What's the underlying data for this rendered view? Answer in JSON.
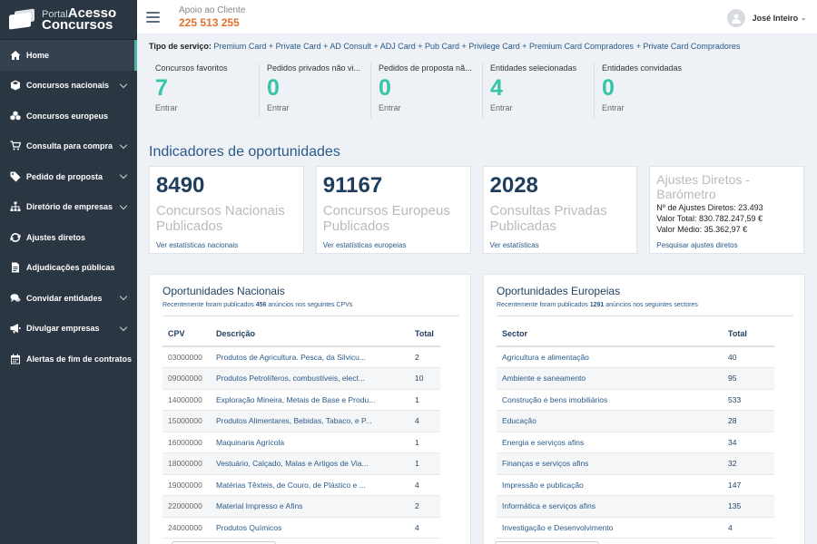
{
  "brand": {
    "portal": "Portal",
    "acesso": "Acesso",
    "concursos": "Concursos"
  },
  "header": {
    "support_label": "Apoio ao Cliente",
    "phone": "225 513 255",
    "user_name": "José Inteiro",
    "dropdown": "⌄"
  },
  "sidebar": {
    "items": [
      {
        "label": "Home",
        "icon": "home-icon",
        "chevron": false
      },
      {
        "label": "Concursos nacionais",
        "icon": "cube-icon",
        "chevron": true
      },
      {
        "label": "Concursos europeus",
        "icon": "cubes-icon",
        "chevron": false
      },
      {
        "label": "Consulta para compra",
        "icon": "cart-icon",
        "chevron": true
      },
      {
        "label": "Pedido de proposta",
        "icon": "tag-icon",
        "chevron": true
      },
      {
        "label": "Diretório de empresas",
        "icon": "sitemap-icon",
        "chevron": true
      },
      {
        "label": "Ajustes diretos",
        "icon": "refresh-icon",
        "chevron": false
      },
      {
        "label": "Adjudicações públicas",
        "icon": "document-icon",
        "chevron": false
      },
      {
        "label": "Convidar entidades",
        "icon": "chat-icon",
        "chevron": true
      },
      {
        "label": "Divulgar empresas",
        "icon": "megaphone-icon",
        "chevron": true
      },
      {
        "label": "Alertas de fim de contratos",
        "icon": "calendar-icon",
        "chevron": false
      }
    ]
  },
  "service": {
    "label": "Tipo de serviço:",
    "types": "Premium Card + Private Card + AD Consult + ADJ Card + Pub Card + Privilege Card + Premium Card Compradores + Private Card Compradores"
  },
  "favs": [
    {
      "title": "Concursos favoritos",
      "value": "7",
      "link": "Entrar"
    },
    {
      "title": "Pedidos privados não vi...",
      "value": "0",
      "link": "Entrar"
    },
    {
      "title": "Pedidos de proposta nã...",
      "value": "0",
      "link": "Entrar"
    },
    {
      "title": "Entidades selecionadas",
      "value": "4",
      "link": "Entrar"
    },
    {
      "title": "Entidades convidadas",
      "value": "0",
      "link": "Entrar"
    }
  ],
  "indicators": {
    "title": "Indicadores de oportunidades",
    "cards": [
      {
        "number": "8490",
        "desc": "Concursos Nacionais Publicados",
        "link": "Ver estatísticas nacionais"
      },
      {
        "number": "91167",
        "desc": "Concursos Europeus Publicados",
        "link": "Ver estatísticas europeias"
      },
      {
        "number": "2028",
        "desc": "Consultas Privadas Publicadas",
        "link": "Ver estatísticas"
      }
    ],
    "barometer": {
      "title": "Ajustes Diretos - Barómetro",
      "line1": "Nº de Ajustes Diretos: 23.493",
      "line2": "Valor Total: 830.782.247,59 €",
      "line3": "Valor Médio: 35.362,97 €",
      "link": "Pesquisar ajustes diretos"
    }
  },
  "nacional": {
    "title": "Oportunidades Nacionais",
    "subtitle_pre": "Recentemente foram publicados ",
    "subtitle_count": "456",
    "subtitle_post": " anúncios nos seguintes CPVs",
    "headers": [
      "CPV",
      "Descrição",
      "Total"
    ],
    "rows": [
      [
        "03000000",
        "Produtos de Agricultura. Pesca, da Silvicu...",
        "2"
      ],
      [
        "09000000",
        "Produtos Petrolíferos, combustíveis, elect...",
        "10"
      ],
      [
        "14000000",
        "Exploração Mineira, Metais de Base e Produ...",
        "1"
      ],
      [
        "15000000",
        "Produtos Alimentares, Bebidas, Tabaco, e P...",
        "4"
      ],
      [
        "16000000",
        "Maquinaria Agrícola",
        "1"
      ],
      [
        "18000000",
        "Vestuário, Calçado, Malas e Artigos de Via...",
        "1"
      ],
      [
        "19000000",
        "Matérias Têxteis, de Couro, de Plástico e ...",
        "4"
      ],
      [
        "22000000",
        "Material Impresso e Afins",
        "2"
      ],
      [
        "24000000",
        "Produtos Químicos",
        "4"
      ]
    ]
  },
  "europeia": {
    "title": "Oportunidades Europeias",
    "subtitle_pre": "Recentemente foram publicados ",
    "subtitle_count": "1291",
    "subtitle_post": " anúncios nos seguintes sectores",
    "headers": [
      "Sector",
      "Total"
    ],
    "rows": [
      [
        "Agricultura e alimentação",
        "40"
      ],
      [
        "Ambiente e saneamento",
        "95"
      ],
      [
        "Construção e bens imobiliários",
        "533"
      ],
      [
        "Educação",
        "28"
      ],
      [
        "Energia e serviços afins",
        "34"
      ],
      [
        "Finanças e serviços afins",
        "32"
      ],
      [
        "Impressão e publicação",
        "147"
      ],
      [
        "Informática e serviços afins",
        "135"
      ],
      [
        "Investigação e Desenvolvimento",
        "4"
      ]
    ]
  }
}
